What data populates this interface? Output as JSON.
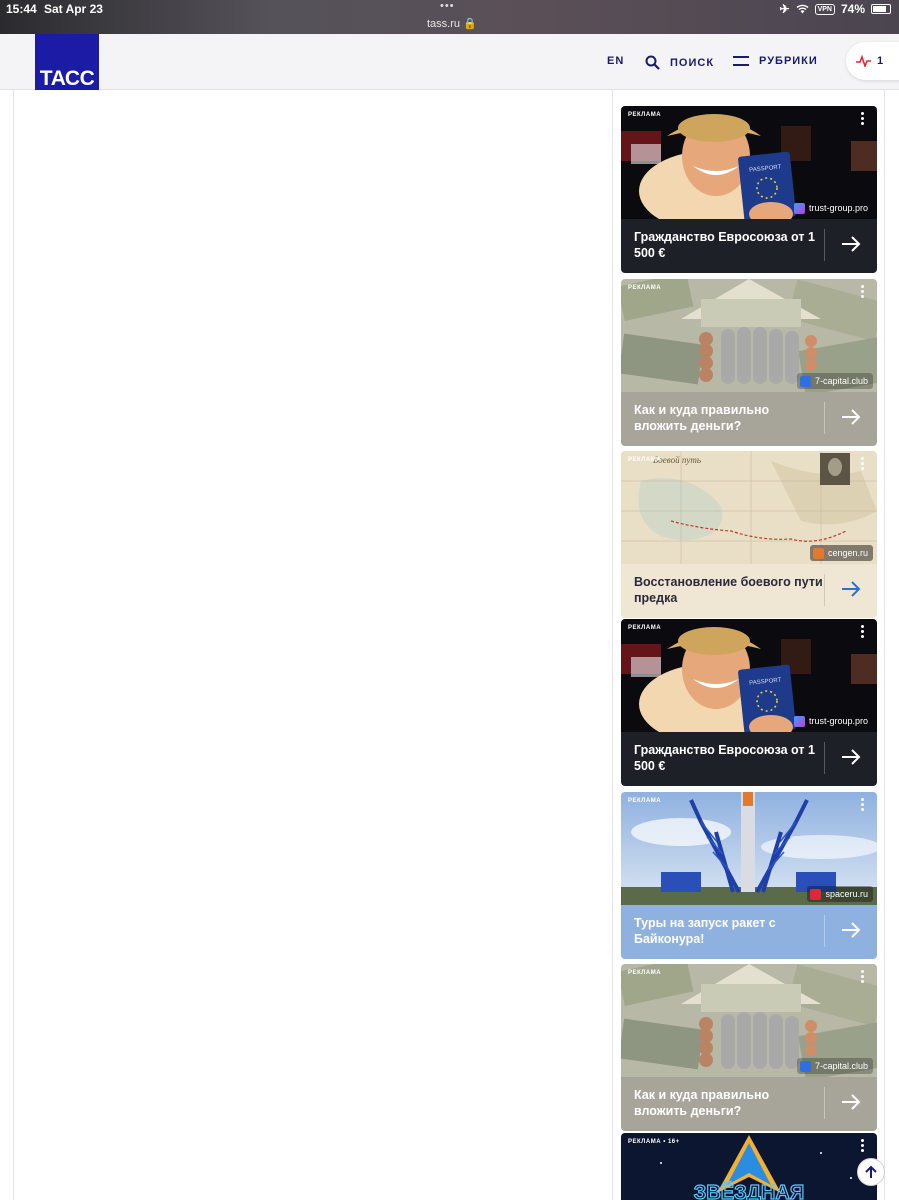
{
  "status_bar": {
    "time": "15:44",
    "date": "Sat Apr 23",
    "url": "tass.ru 🔒",
    "vpn": "VPN",
    "battery": "74%"
  },
  "header": {
    "logo": "ТАСС",
    "lang": "EN",
    "search": "ПОИСК",
    "rubrics": "РУБРИКИ",
    "pulse_count": "1"
  },
  "ads": [
    {
      "label": "РЕКЛАМА",
      "title": "Гражданство Евросоюза от 1 500 €",
      "source": "trust-group.pro",
      "theme": "dark"
    },
    {
      "label": "РЕКЛАМА",
      "title": "Как и куда правильно вложить деньги?",
      "source": "7-capital.club",
      "theme": "grey"
    },
    {
      "label": "РЕКЛАМА",
      "title": "Восстановление боевого пути предка",
      "source": "cengen.ru",
      "theme": "beige",
      "map_text": "Боевой путь"
    },
    {
      "label": "РЕКЛАМА",
      "title": "Гражданство Евросоюза от 1 500 €",
      "source": "trust-group.pro",
      "theme": "dark"
    },
    {
      "label": "РЕКЛАМА",
      "title": "Туры на запуск ракет с Байконура!",
      "source": "spaceru.ru",
      "theme": "blue"
    },
    {
      "label": "РЕКЛАМА",
      "title": "Как и куда правильно вложить деньги?",
      "source": "7-capital.club",
      "theme": "grey"
    },
    {
      "label": "РЕКЛАМА • 16+",
      "title": "ЗВЁЗДНАЯ"
    }
  ],
  "passport_text": "PASSPORT"
}
